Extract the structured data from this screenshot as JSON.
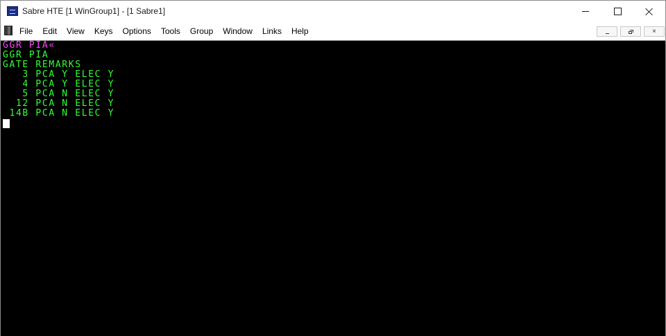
{
  "window": {
    "title": "Sabre HTE [1 WinGroup1] - [1 Sabre1]"
  },
  "menu": {
    "items": [
      {
        "label": "File"
      },
      {
        "label": "Edit"
      },
      {
        "label": "View"
      },
      {
        "label": "Keys"
      },
      {
        "label": "Options"
      },
      {
        "label": "Tools"
      },
      {
        "label": "Group"
      },
      {
        "label": "Window"
      },
      {
        "label": "Links"
      },
      {
        "label": "Help"
      }
    ]
  },
  "icons": {
    "app": "sabre-app-icon",
    "menu": "terminal-menu-icon",
    "minimize": "minimize-icon",
    "maximize": "maximize-icon",
    "close": "close-icon",
    "mdi_minimize": "mdi-minimize-icon",
    "mdi_restore": "mdi-restore-icon",
    "mdi_close": "mdi-close-icon"
  },
  "mdi_controls": {
    "close_glyph": "×"
  },
  "colors": {
    "terminal_background": "#000000",
    "input_text": "#ff44ff",
    "output_text": "#33ff33",
    "cursor": "#ffffff"
  },
  "terminal": {
    "lines": [
      {
        "text": "GGR PIA«",
        "color": "#ff44ff"
      },
      {
        "text": "GGR PIA",
        "color": "#33ff33"
      },
      {
        "text": "GATE REMARKS",
        "color": "#33ff33"
      },
      {
        "text": "   3 PCA Y ELEC Y",
        "color": "#33ff33"
      },
      {
        "text": "   4 PCA Y ELEC Y",
        "color": "#33ff33"
      },
      {
        "text": "   5 PCA N ELEC Y",
        "color": "#33ff33"
      },
      {
        "text": "  12 PCA N ELEC Y",
        "color": "#33ff33"
      },
      {
        "text": " 14B PCA N ELEC Y",
        "color": "#33ff33"
      }
    ]
  }
}
